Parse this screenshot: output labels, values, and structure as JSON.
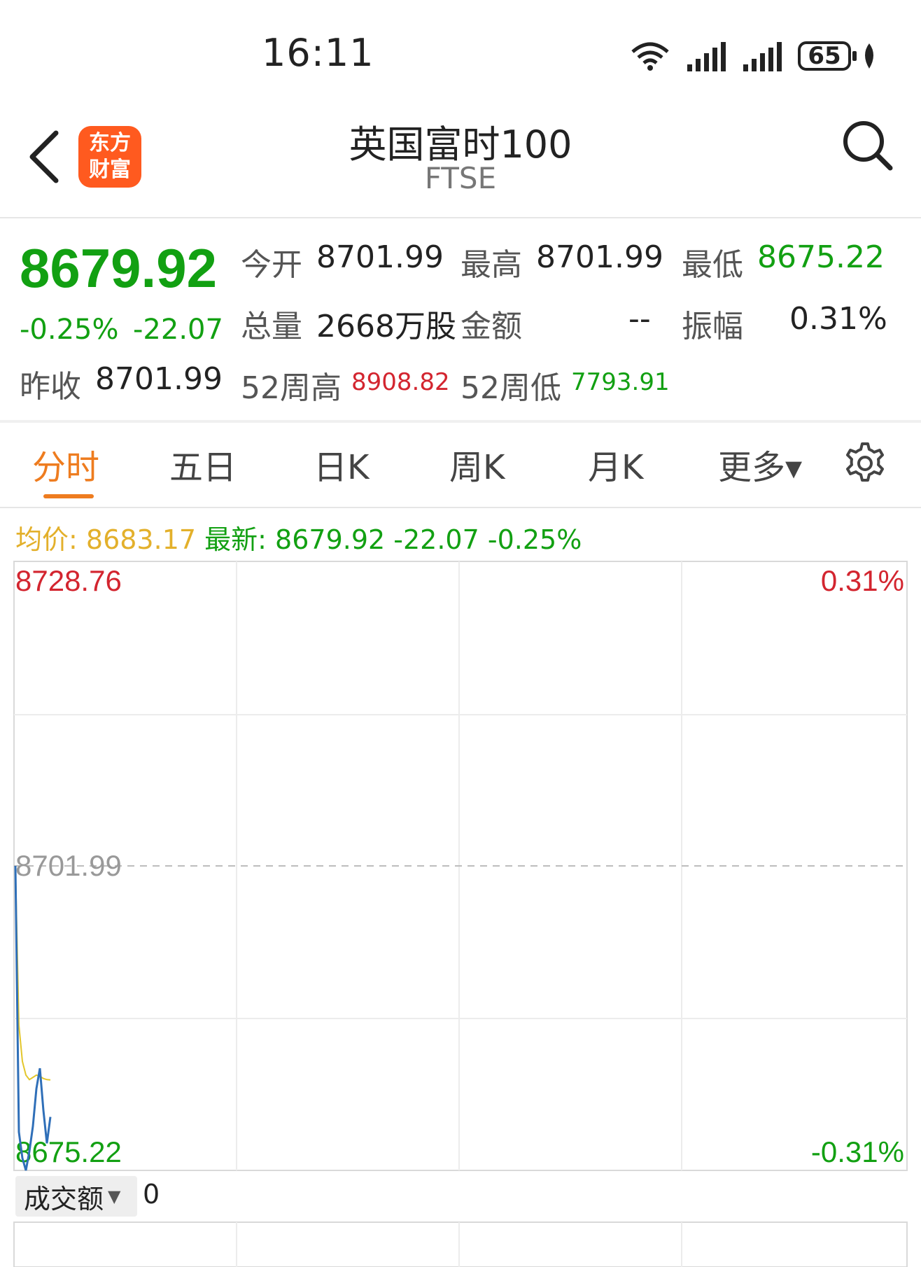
{
  "status_bar": {
    "time": "16:11",
    "battery": "65",
    "icons": [
      "wifi-icon",
      "signal-icon",
      "signal-icon",
      "battery-icon",
      "leaf-icon"
    ]
  },
  "header": {
    "title": "英国富时100",
    "subtitle": "FTSE",
    "logo_line1": "东方",
    "logo_line2": "财富"
  },
  "quote": {
    "price": "8679.92",
    "change_pct": "-0.25%",
    "change": "-22.07",
    "prev_close_label": "昨收",
    "prev_close": "8701.99",
    "open_label": "今开",
    "open": "8701.99",
    "high_label": "最高",
    "high": "8701.99",
    "low_label": "最低",
    "low": "8675.22",
    "volume_label": "总量",
    "volume": "2668万股",
    "amount_label": "金额",
    "amount": "--",
    "amplitude_label": "振幅",
    "amplitude": "0.31%",
    "wk52_high_label": "52周高",
    "wk52_high": "8908.82",
    "wk52_low_label": "52周低",
    "wk52_low": "7793.91"
  },
  "tabs": [
    {
      "label": "分时",
      "active": true
    },
    {
      "label": "五日",
      "active": false
    },
    {
      "label": "日K",
      "active": false
    },
    {
      "label": "周K",
      "active": false
    },
    {
      "label": "月K",
      "active": false
    },
    {
      "label": "更多▾",
      "active": false
    }
  ],
  "info_line": {
    "avg_label": "均价:",
    "avg_value": "8683.17",
    "latest_label": "最新:",
    "latest_value": "8679.92",
    "latest_change": "-22.07",
    "latest_pct": "-0.25%"
  },
  "chart_data": {
    "type": "line",
    "y_top_label": "8728.76",
    "y_mid_label": "8701.99",
    "y_bottom_label": "8675.22",
    "pct_top_label": "0.31%",
    "pct_bottom_label": "-0.31%",
    "ylim": [
      8675.22,
      8728.76
    ],
    "baseline": 8701.99,
    "series": [
      {
        "values": [
          8701.99,
          8678.6,
          8676.3,
          8675.22,
          8676.9,
          8679.1,
          8682.4,
          8684.2,
          8680.5,
          8677.6,
          8679.92
        ],
        "color": "#2f6fb8"
      },
      {
        "values": [
          8701.99,
          8688.0,
          8684.8,
          8683.6,
          8683.2,
          8683.4,
          8683.6,
          8683.5,
          8683.3,
          8683.2,
          8683.17
        ],
        "color": "#e3c62b"
      }
    ]
  },
  "volume": {
    "label": "成交额",
    "value": "0"
  },
  "colors": {
    "up": "#d3252f",
    "down": "#12a012",
    "accent": "#ee7c1f",
    "avg_line": "#e3c62b",
    "price_line": "#2f6fb8"
  }
}
